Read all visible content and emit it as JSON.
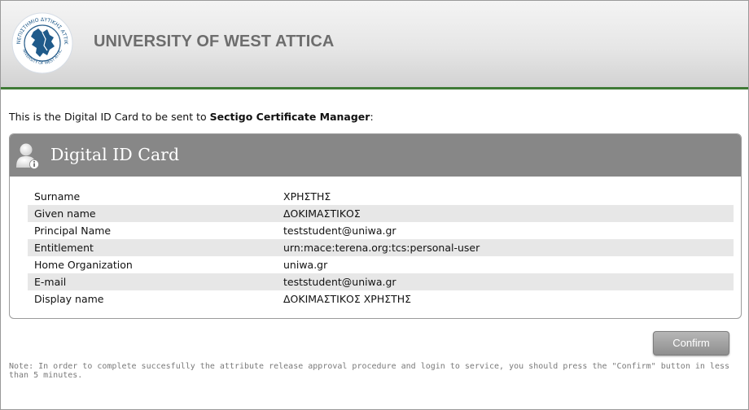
{
  "header": {
    "logo_icon": "university-seal-logo",
    "logo_text": "ΠΑΝΕΠΙΣΤΗΜΙΟ ΔΥΤΙΚΗΣ ΑΤΤΙΚΗΣ",
    "logo_subtext": "UNIVERSITY OF WEST ATTICA",
    "title": "UNIVERSITY OF WEST ATTICA",
    "accent_color": "#3f7a36"
  },
  "intro": {
    "prefix": "This is the Digital ID Card to be sent to ",
    "service": "Sectigo Certificate Manager",
    "suffix": ":"
  },
  "card": {
    "icon": "user-info-icon",
    "title": "Digital ID Card",
    "attributes": [
      {
        "name": "Surname",
        "value": "ΧΡΗΣΤΗΣ"
      },
      {
        "name": "Given name",
        "value": "ΔΟΚΙΜΑΣΤΙΚΟΣ"
      },
      {
        "name": "Principal Name",
        "value": "teststudent@uniwa.gr"
      },
      {
        "name": "Entitlement",
        "value": "urn:mace:terena.org:tcs:personal-user"
      },
      {
        "name": "Home Organization",
        "value": "uniwa.gr"
      },
      {
        "name": "E-mail",
        "value": "teststudent@uniwa.gr"
      },
      {
        "name": "Display name",
        "value": "ΔΟΚΙΜΑΣΤΙΚΟΣ ΧΡΗΣΤΗΣ"
      }
    ]
  },
  "actions": {
    "confirm_label": "Confirm"
  },
  "note": "Note: In order to complete succesfully the attribute release approval procedure and login to service, you should press the \"Confirm\" button in less than 5 minutes."
}
